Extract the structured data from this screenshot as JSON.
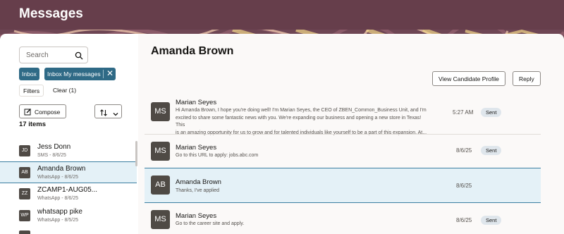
{
  "header": {
    "title": "Messages"
  },
  "search": {
    "placeholder": "Search"
  },
  "chips": {
    "inbox": "Inbox",
    "inbox_my": "Inbox My messages"
  },
  "filters": {
    "label": "Filters",
    "clear": "Clear (1)"
  },
  "compose": {
    "label": "Compose"
  },
  "list": {
    "count": "17 items",
    "items": [
      {
        "avatar": "JD",
        "name": "Jess Donn",
        "sub": "SMS - 8/6/25"
      },
      {
        "avatar": "AB",
        "name": "Amanda Brown",
        "sub": "WhatsApp - 8/6/25"
      },
      {
        "avatar": "ZZ",
        "name": "ZCAMP1-AUG05...",
        "sub": "WhatsApp - 8/6/25"
      },
      {
        "avatar": "WP",
        "name": "whatsapp pike",
        "sub": "WhatsApp - 8/5/25"
      }
    ]
  },
  "conversation": {
    "title": "Amanda Brown",
    "view_profile": "View Candidate Profile",
    "reply": "Reply",
    "messages": [
      {
        "avatar": "MS",
        "sender": "Marian Seyes",
        "lines": [
          "Hi Amanda Brown, I hope you're doing well! I'm Marian Seyes, the CEO of ZBEN_Common_Business Unit, and I'm",
          "excited to share some fantastic news with you. We're expanding our business and opening a new store in Texas! This",
          "is an amazing opportunity for us to grow and for talented individuals like yourself to be a part of this expansion. At..."
        ],
        "time": "5:27 AM",
        "status": "Sent"
      },
      {
        "avatar": "MS",
        "sender": "Marian Seyes",
        "lines": [
          "Go to this URL to apply: jobs.abc.com"
        ],
        "time": "8/6/25",
        "status": "Sent"
      },
      {
        "avatar": "AB",
        "sender": "Amanda Brown",
        "lines": [
          "Thanks, I've applied"
        ],
        "time": "8/6/25",
        "status": ""
      },
      {
        "avatar": "MS",
        "sender": "Marian Seyes",
        "lines": [
          "Go to the career site and apply."
        ],
        "time": "8/6/25",
        "status": "Sent"
      }
    ]
  },
  "colors": {
    "header": "#663e4b",
    "chip": "#2f6a86",
    "selected": "#e4f1f7",
    "accent": "#3b7ea1"
  }
}
